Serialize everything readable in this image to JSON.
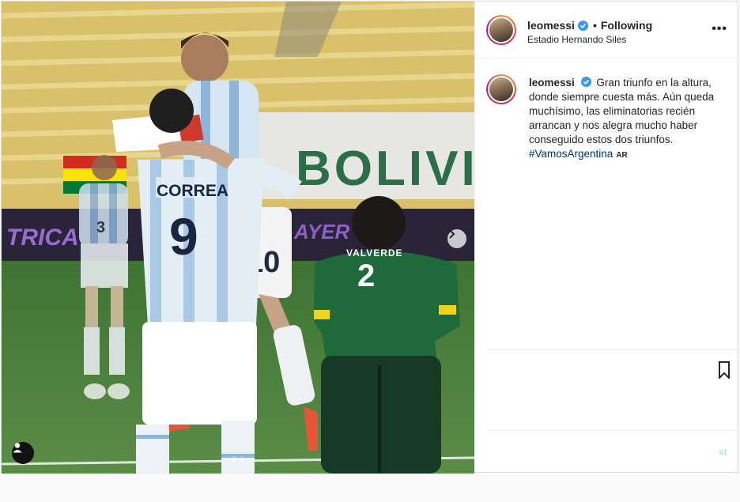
{
  "post": {
    "username": "leomessi",
    "header_separator": "•",
    "follow_status": "Following",
    "location": "Estadio Hernando Siles",
    "more_icon": "•••",
    "caption": {
      "username": "leomessi",
      "text": "Gran triunfo en la altura, donde siempre cuesta más. Aún queda muchísimo, las eliminatorias recién arrancan y nos alegra mucho haber conseguido estos dos triunfos.",
      "hashtag": "#VamosArgentina",
      "language": "AR"
    },
    "comment_post_label": "st"
  },
  "media": {
    "banner_text": "BOLIVIA",
    "ad_text_left": "TRICA",
    "ad_text_right": "AYER",
    "jersey_back_name": "CORREA",
    "jersey_back_number": "9",
    "shorts_number": "10",
    "opponent_name": "VALVERDE",
    "opponent_number": "2",
    "background_number": "3",
    "carousel_total": 2,
    "carousel_active": 1
  },
  "colors": {
    "link": "#00376b",
    "verified": "#3897f0",
    "border": "#dbdbdb"
  }
}
